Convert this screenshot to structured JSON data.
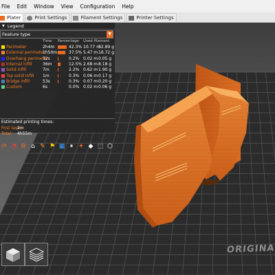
{
  "menu": {
    "items": [
      "File",
      "Edit",
      "Window",
      "View",
      "Configuration",
      "Help"
    ]
  },
  "tabs": [
    {
      "label": "Plater",
      "active": true,
      "icon": "plater-icon"
    },
    {
      "label": "Print Settings",
      "active": false,
      "icon": "print-settings-icon"
    },
    {
      "label": "Filament Settings",
      "active": false,
      "icon": "filament-settings-icon"
    },
    {
      "label": "Printer Settings",
      "active": false,
      "icon": "printer-settings-icon"
    }
  ],
  "legend": {
    "title": "Legend",
    "view_type": "Feature type",
    "columns": {
      "time": "Time",
      "percentage": "Percentage",
      "used": "Used filament"
    },
    "rows": [
      {
        "name": "Perimeter",
        "time": "2h4m",
        "percent": "42.3%",
        "fraction": 0.423,
        "length": "10.77 m",
        "weight": "32.89 g",
        "color": "#ffe500"
      },
      {
        "name": "External perimeter",
        "time": "1h50m",
        "percent": "37.5%",
        "fraction": 0.375,
        "length": "5.47 m",
        "weight": "16.72 g",
        "color": "#ff7d38"
      },
      {
        "name": "Overhang perimeter",
        "time": "32s",
        "percent": "0.2%",
        "fraction": 0.002,
        "length": "0.02 m",
        "weight": "0.05 g",
        "color": "#1f1fff"
      },
      {
        "name": "Internal infill",
        "time": "36m",
        "percent": "12.5%",
        "fraction": 0.125,
        "length": "2.68 m",
        "weight": "8.18 g",
        "color": "#b03029"
      },
      {
        "name": "Solid infill",
        "time": "7m",
        "percent": "2.2%",
        "fraction": 0.022,
        "length": "0.62 m",
        "weight": "1.90 g",
        "color": "#9654cc"
      },
      {
        "name": "Top solid infill",
        "time": "1m",
        "percent": "0.3%",
        "fraction": 0.003,
        "length": "0.06 m",
        "weight": "0.17 g",
        "color": "#f04040"
      },
      {
        "name": "Bridge infill",
        "time": "53s",
        "percent": "0.3%",
        "fraction": 0.003,
        "length": "0.07 m",
        "weight": "0.20 g",
        "color": "#4d80ba"
      },
      {
        "name": "Custom",
        "time": "6s",
        "percent": "0.0%",
        "fraction": 0.0,
        "length": "0.02 m",
        "weight": "0.06 g",
        "color": "#5ed194"
      }
    ],
    "estimated_label": "Estimated printing times:",
    "estimates": [
      {
        "key": "First layer:",
        "value": "2m"
      },
      {
        "key": "Total:",
        "value": "4h55m"
      }
    ]
  },
  "toolbar_icons": [
    "travel-icon",
    "wipe-icon",
    "retractions-icon",
    "deretractions-icon",
    "seams-icon",
    "tool-changes-icon",
    "color-changes-icon",
    "pause-prints-icon",
    "custom-gcodes-icon",
    "center-of-gravity-icon",
    "shells-icon",
    "tool-marker-icon"
  ],
  "bed": {
    "brand_text": "ORIGINA"
  },
  "colors": {
    "accent": "#ed6b21",
    "model": "#e8731f",
    "bed": "#2b2b2b",
    "grid": "#555555"
  }
}
